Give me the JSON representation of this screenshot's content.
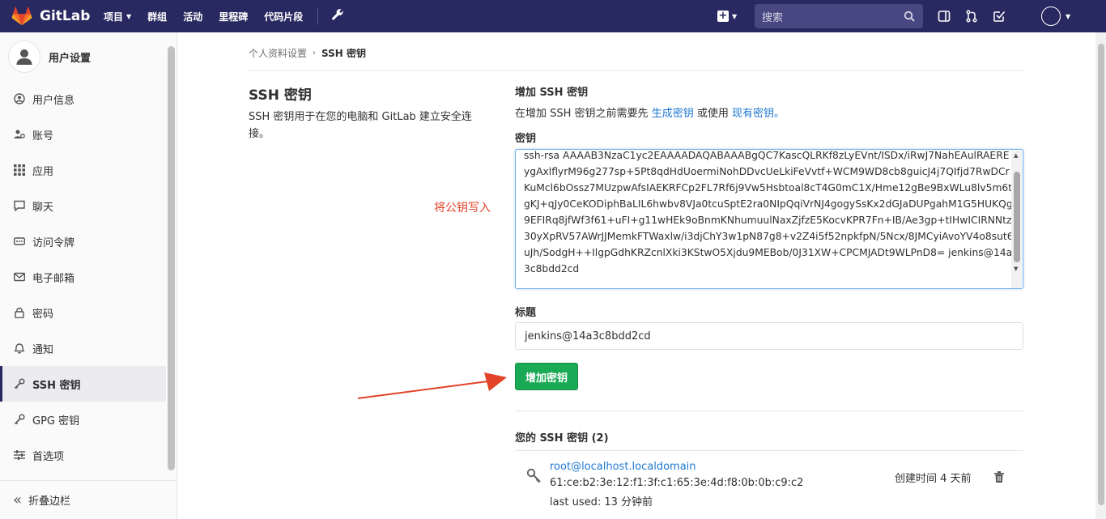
{
  "navbar": {
    "brand": "GitLab",
    "links": [
      {
        "label": "项目",
        "has_caret": true
      },
      {
        "label": "群组",
        "has_caret": false
      },
      {
        "label": "活动",
        "has_caret": false
      },
      {
        "label": "里程碑",
        "has_caret": false
      },
      {
        "label": "代码片段",
        "has_caret": false
      }
    ],
    "search_placeholder": "搜索",
    "icons": [
      "gitlab-logo-icon",
      "wrench-icon",
      "plus-square-icon",
      "search-icon",
      "sidebar-panel-icon",
      "merge-request-icon",
      "todo-check-icon",
      "user-avatar-icon"
    ]
  },
  "sidebar": {
    "title": "用户设置",
    "items": [
      {
        "label": "用户信息",
        "icon": "profile-icon",
        "active": false
      },
      {
        "label": "账号",
        "icon": "account-icon",
        "active": false
      },
      {
        "label": "应用",
        "icon": "applications-icon",
        "active": false
      },
      {
        "label": "聊天",
        "icon": "chat-icon",
        "active": false
      },
      {
        "label": "访问令牌",
        "icon": "token-icon",
        "active": false
      },
      {
        "label": "电子邮箱",
        "icon": "mail-icon",
        "active": false
      },
      {
        "label": "密码",
        "icon": "lock-icon",
        "active": false
      },
      {
        "label": "通知",
        "icon": "bell-icon",
        "active": false
      },
      {
        "label": "SSH 密钥",
        "icon": "key-icon",
        "active": true
      },
      {
        "label": "GPG 密钥",
        "icon": "key-icon",
        "active": false
      },
      {
        "label": "首选项",
        "icon": "preferences-icon",
        "active": false
      }
    ],
    "collapse_label": "折叠边栏"
  },
  "breadcrumb": {
    "parent": "个人资料设置",
    "current": "SSH 密钥"
  },
  "left": {
    "title": "SSH 密钥",
    "description": "SSH 密钥用于在您的电脑和 GitLab 建立安全连接。"
  },
  "form": {
    "title": "增加 SSH 密钥",
    "intro_before": "在增加 SSH 密钥之前需要先 ",
    "intro_link1": "生成密钥",
    "intro_middle": " 或使用 ",
    "intro_link2": "现有密钥。",
    "key_label": "密钥",
    "key_value": "ssh-rsa AAAAB3NzaC1yc2EAAAADAQABAAABgQC7KascQLRKf8zLyEVnt/ISDx/iRwJ7NahEAulRAEREygAxlflyrM96g277sp+5Pt8qdHdUoermiNohDDvcUeLkiFeVvtf+WCM9WD8cb8guicJ4j7QIfjd7RwDCrKuMcl6bOssz7MUzpwAfsIAEKRFCp2FL7Rf6j9Vw5Hsbtoal8cT4G0mC1X/Hme12gBe9BxWLu8lv5m6tgKJ+qJy0CeKODiphBaLIL6hwbv8VJa0tcuSptE2ra0NIpQqiVrNJ4gogySsKx2dGJaDUPgahM1G5HUKQg9EFIRq8jfWf3f61+uFI+g11wHEk9oBnmKNhumuulNaxZjfzE5KocvKPR7Fn+IB/Ae3gp+tIHwICIRNNtz30yXpRV57AWrJJMemkFTWaxlw/i3djChY3w1pN87g8+v2Z4i5f52npkfpN/5Ncx/8JMCyiAvoYV4o8sut6uJh/SodgH++IlgpGdhKRZcnlXki3KStwO5Xjdu9MEBob/0J31XW+CPCMJADt9WLPnD8= jenkins@14a3c8bdd2cd",
    "annotation": "将公钥写入",
    "title_label": "标题",
    "title_value": "jenkins@14a3c8bdd2cd",
    "add_button": "增加密钥"
  },
  "keys": {
    "heading": "您的 SSH 密钥 (2)",
    "items": [
      {
        "name": "root@localhost.localdomain",
        "fingerprint": "61:ce:b2:3e:12:f1:3f:c1:65:3e:4d:f8:0b:0b:c9:c2",
        "last_used": "last used: 13 分钟前",
        "created": "创建时间 4 天前"
      }
    ]
  },
  "colors": {
    "navbar": "#292961",
    "primary_button": "#1aaa55",
    "link": "#1f78d1",
    "annotation": "#e24329"
  }
}
